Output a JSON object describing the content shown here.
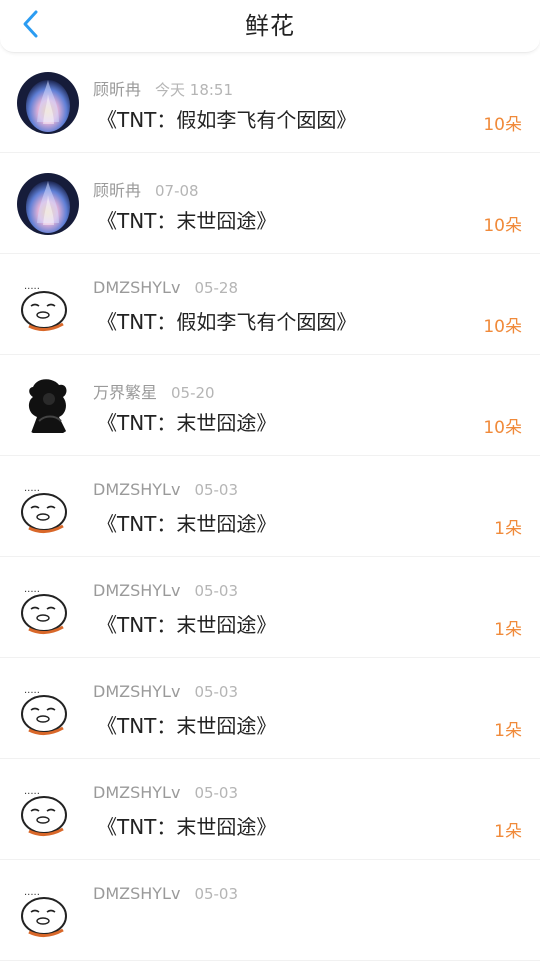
{
  "header": {
    "title": "鲜花"
  },
  "colors": {
    "accent": "#2b9cf2",
    "flower_count": "#f08a3a"
  },
  "items": [
    {
      "user": "顾昕冉",
      "time": "今天 18:51",
      "book": "《TNT：假如李飞有个囡囡》",
      "count": "10朵",
      "avatar": "blue-flame"
    },
    {
      "user": "顾昕冉",
      "time": "07-08",
      "book": "《TNT：末世囧途》",
      "count": "10朵",
      "avatar": "blue-flame"
    },
    {
      "user": "DMZSHYLv",
      "time": "05-28",
      "book": "《TNT：假如李飞有个囡囡》",
      "count": "10朵",
      "avatar": "meme-face"
    },
    {
      "user": "万界繁星",
      "time": "05-20",
      "book": "《TNT：末世囧途》",
      "count": "10朵",
      "avatar": "dark-figure"
    },
    {
      "user": "DMZSHYLv",
      "time": "05-03",
      "book": "《TNT：末世囧途》",
      "count": "1朵",
      "avatar": "meme-face"
    },
    {
      "user": "DMZSHYLv",
      "time": "05-03",
      "book": "《TNT：末世囧途》",
      "count": "1朵",
      "avatar": "meme-face"
    },
    {
      "user": "DMZSHYLv",
      "time": "05-03",
      "book": "《TNT：末世囧途》",
      "count": "1朵",
      "avatar": "meme-face"
    },
    {
      "user": "DMZSHYLv",
      "time": "05-03",
      "book": "《TNT：末世囧途》",
      "count": "1朵",
      "avatar": "meme-face"
    },
    {
      "user": "DMZSHYLv",
      "time": "05-03",
      "book": "",
      "count": "",
      "avatar": "meme-face"
    }
  ]
}
